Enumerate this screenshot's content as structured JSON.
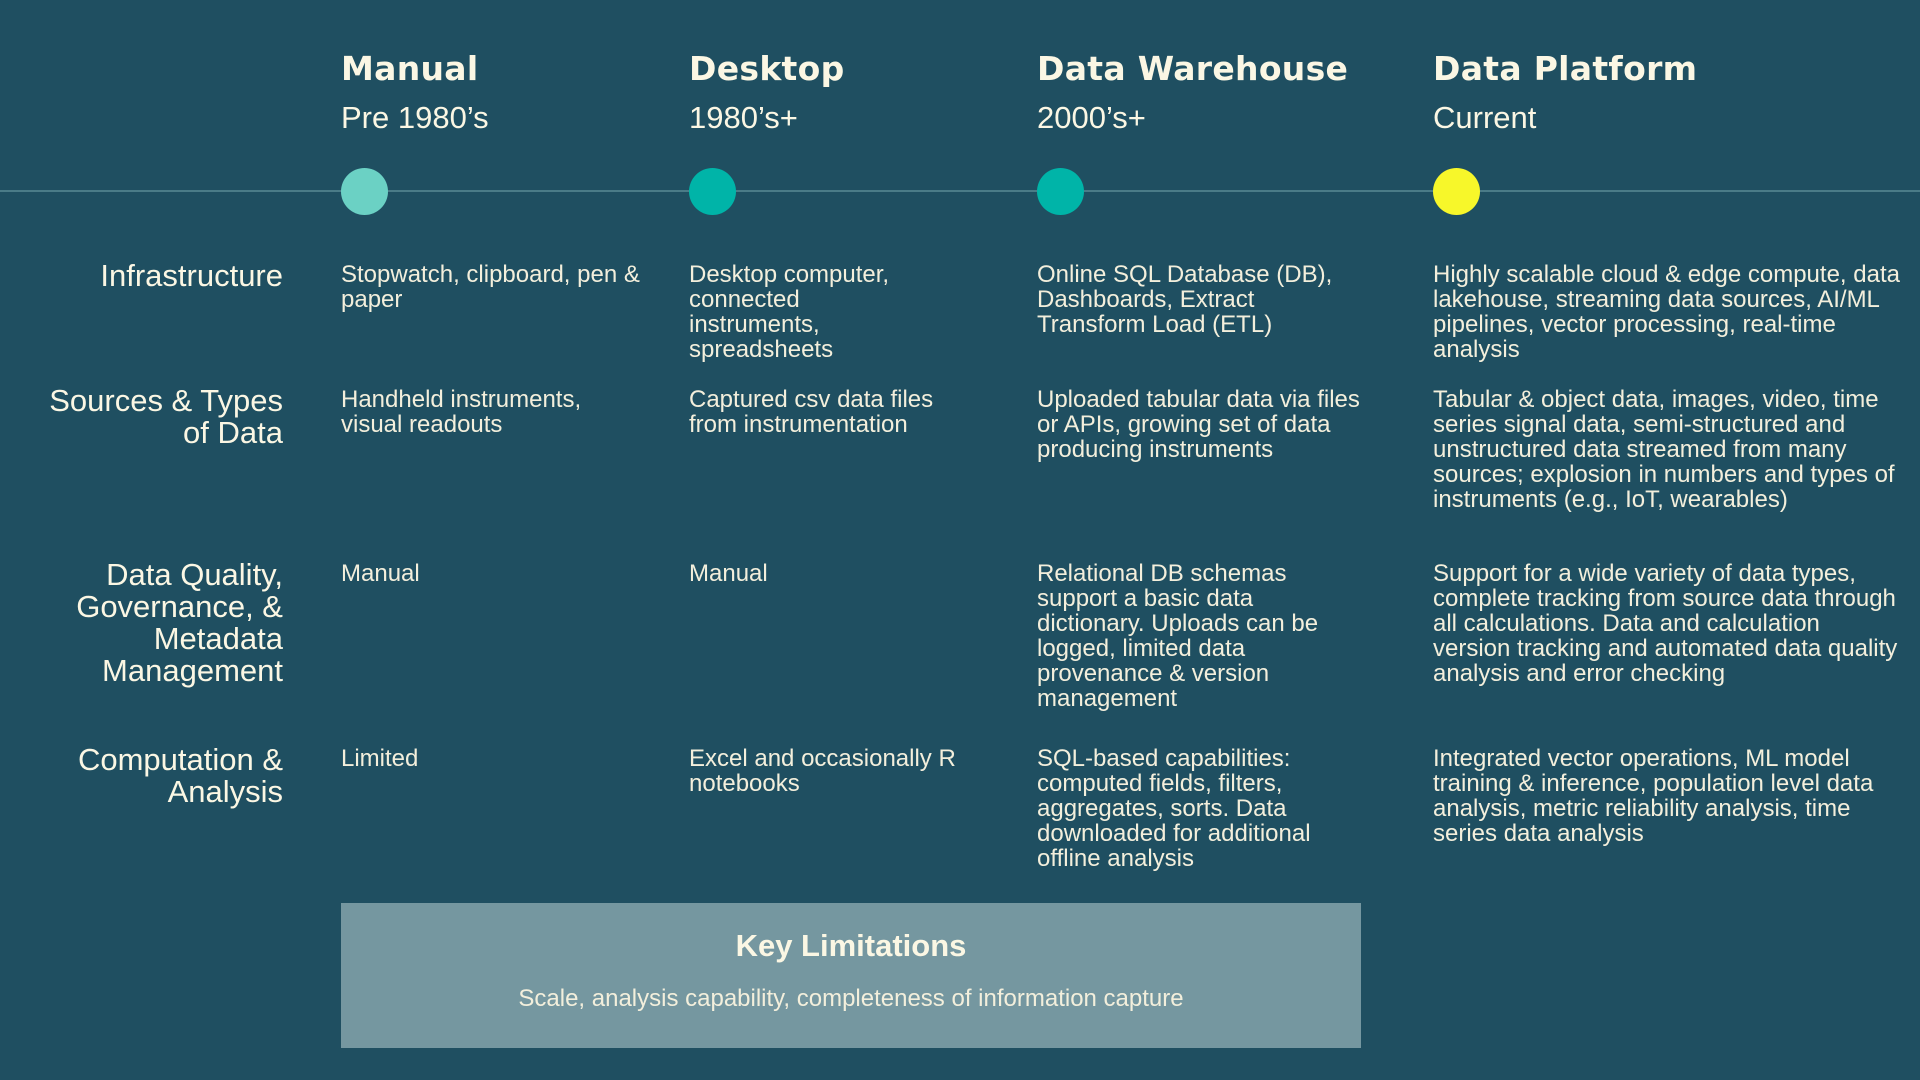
{
  "colors": {
    "background": "#1f4f61",
    "text": "#fbf7e4",
    "timeline_line": "#4a7b87",
    "limitations_box": "#7597a0"
  },
  "eras": [
    {
      "title": "Manual",
      "period": "Pre 1980’s",
      "dot_color": "#6bd1c4"
    },
    {
      "title": "Desktop",
      "period": "1980’s+",
      "dot_color": "#00b4a8"
    },
    {
      "title": "Data Warehouse",
      "period": "2000’s+",
      "dot_color": "#00b4a8"
    },
    {
      "title": "Data Platform",
      "period": "Current",
      "dot_color": "#f7f72a"
    }
  ],
  "rows": [
    {
      "label": "Infrastructure",
      "cells": [
        "Stopwatch, clipboard, pen & paper",
        "Desktop computer, connected instruments, spreadsheets",
        "Online SQL Database (DB), Dashboards, Extract Transform Load (ETL)",
        "Highly scalable cloud & edge compute, data lakehouse, streaming data sources, AI/ML pipelines, vector processing, real-time analysis"
      ]
    },
    {
      "label": "Sources & Types of Data",
      "cells": [
        "Handheld instruments, visual readouts",
        "Captured csv data files from instrumentation",
        "Uploaded tabular data via files or APIs, growing set of data producing instruments",
        "Tabular & object data, images, video, time series signal data, semi-structured and unstructured data streamed from many sources; explosion in numbers and types of instruments (e.g., IoT, wearables)"
      ]
    },
    {
      "label": "Data Quality, Governance, & Metadata Management",
      "cells": [
        "Manual",
        "Manual",
        "Relational DB schemas support a basic data dictionary. Uploads can be logged, limited data provenance & version management",
        "Support for a wide variety of data types, complete tracking from source data through all calculations. Data and calculation version tracking and automated data quality analysis and error checking"
      ]
    },
    {
      "label": "Computation & Analysis",
      "cells": [
        "Limited",
        "Excel and occasionally R notebooks",
        "SQL-based capabilities: computed fields, filters, aggregates, sorts. Data downloaded for additional offline analysis",
        "Integrated vector operations, ML model training & inference, population level data analysis, metric reliability analysis, time series data analysis"
      ]
    }
  ],
  "limitations": {
    "title": "Key Limitations",
    "text": "Scale, analysis capability, completeness of information capture"
  }
}
